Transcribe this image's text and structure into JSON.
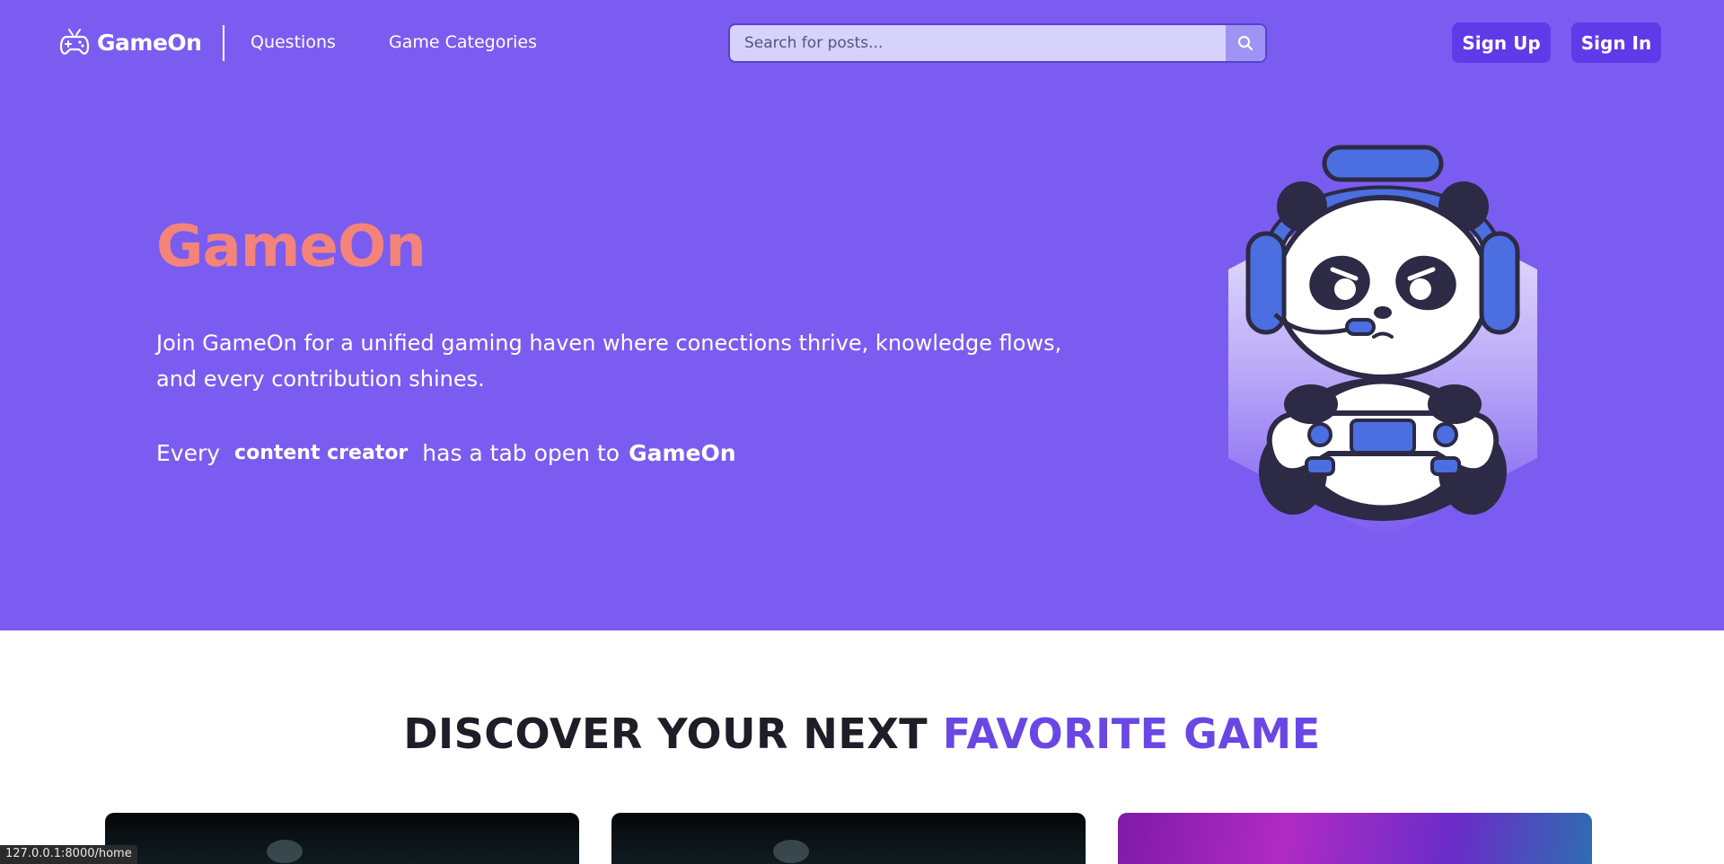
{
  "header": {
    "brand": "GameOn",
    "nav": {
      "questions": "Questions",
      "categories": "Game Categories"
    },
    "search": {
      "placeholder": "Search for posts..."
    },
    "auth": {
      "signup": "Sign Up",
      "signin": "Sign In"
    }
  },
  "hero": {
    "title": "GameOn",
    "description": "Join GameOn for a unified gaming haven where conections thrive, knowledge flows, and every contribution shines.",
    "tagline": {
      "prefix": "Every",
      "highlight": "content creator",
      "middle": "has a tab open to",
      "brand": "GameOn"
    }
  },
  "discover": {
    "title_main": "DISCOVER YOUR NEXT",
    "title_accent": "FAVORITE GAME"
  },
  "status_bar": {
    "url": "127.0.0.1:8000/home"
  },
  "colors": {
    "hero_bg": "#7b5cf0",
    "title_coral": "#f4847a",
    "button_bg": "#5e3ae8",
    "accent": "#6a47e4"
  },
  "icons": {
    "brand": "gamepad-icon",
    "search": "search-icon",
    "mascot": "panda-gamer-mascot"
  }
}
